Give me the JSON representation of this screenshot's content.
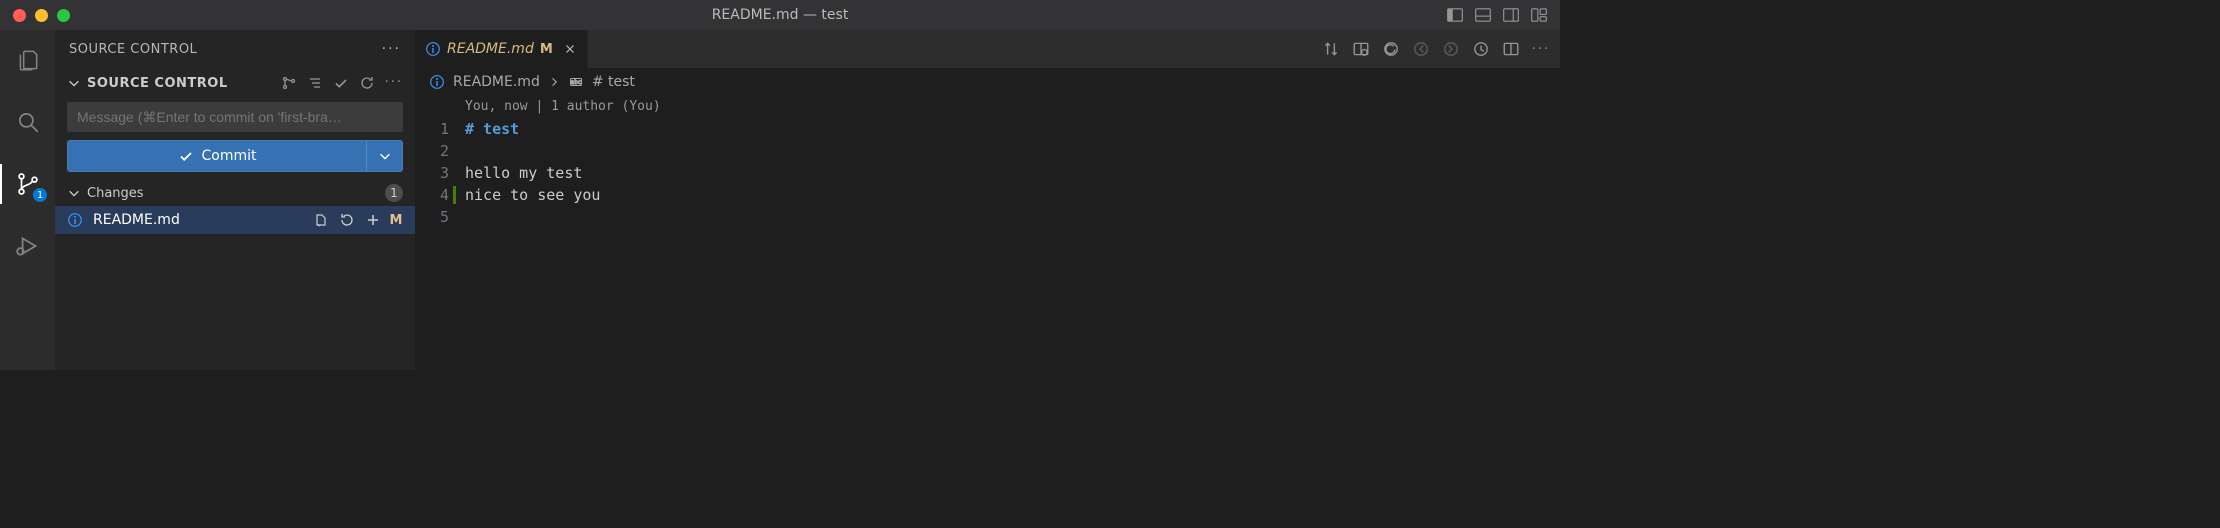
{
  "window": {
    "title": "README.md — test"
  },
  "activity": {
    "scm_badge": "1"
  },
  "sidebar": {
    "panel_title": "SOURCE CONTROL",
    "provider_title": "SOURCE CONTROL",
    "msg_placeholder": "Message (⌘Enter to commit on 'first-bra…",
    "commit_label": "Commit",
    "changes_label": "Changes",
    "changes_count": "1",
    "file": {
      "name": "README.md",
      "status": "M"
    }
  },
  "tab": {
    "name": "README.md",
    "status": "M"
  },
  "breadcrumb": {
    "file": "README.md",
    "symbol": "# test"
  },
  "editor": {
    "codelens": "You, now | 1 author (You)",
    "lines": {
      "l1": "# test",
      "l2": "",
      "l3": "hello my test",
      "l4": "nice to see you",
      "l5": ""
    },
    "ln": {
      "n1": "1",
      "n2": "2",
      "n3": "3",
      "n4": "4",
      "n5": "5"
    }
  }
}
